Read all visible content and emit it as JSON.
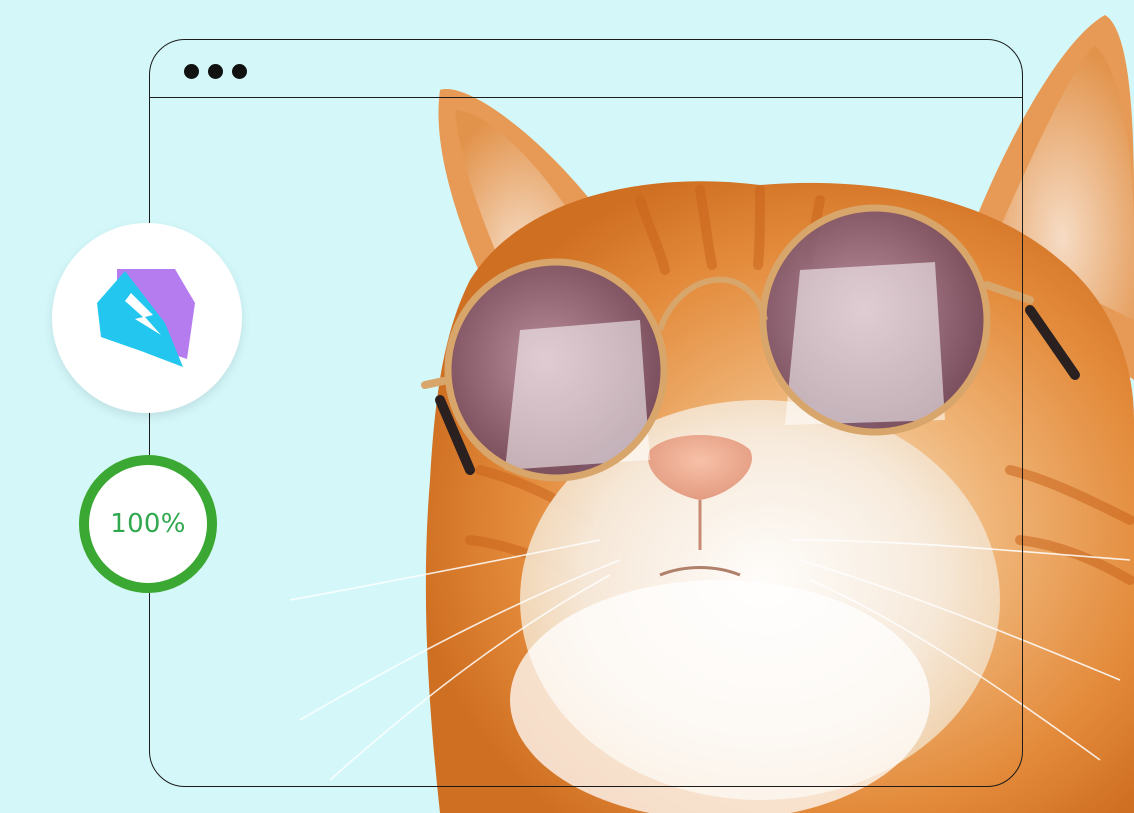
{
  "colors": {
    "background": "#d4f8fa",
    "frame": "#1b1b1b",
    "progress": "#3aa832",
    "progress_text": "#2fa84f",
    "logo_purple": "#b57cf0",
    "logo_cyan": "#22c6ee"
  },
  "window": {
    "controls": [
      "dot",
      "dot",
      "dot"
    ]
  },
  "app_badge": {
    "icon": "lightning-speech-bubble-logo-icon"
  },
  "progress": {
    "value": 1.0,
    "label": "100%"
  },
  "hero_image": {
    "icon": "ginger-cat-with-round-sunglasses-image"
  }
}
